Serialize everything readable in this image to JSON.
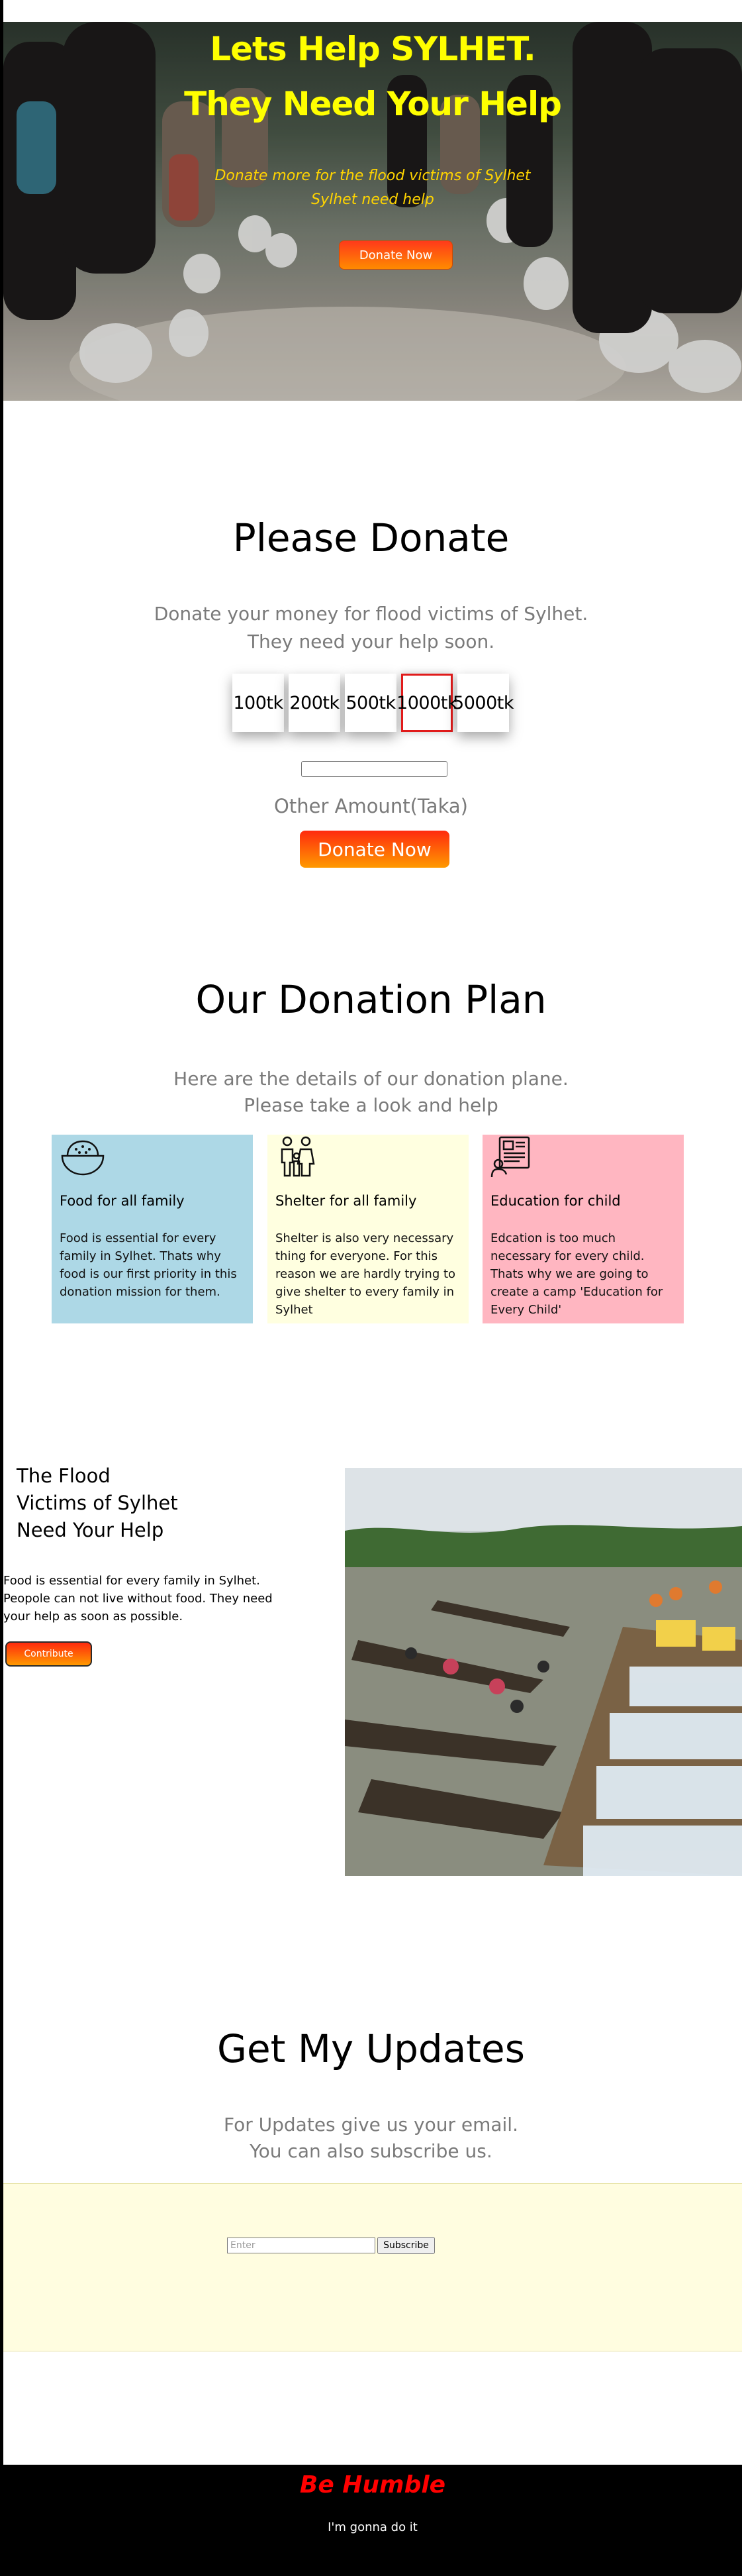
{
  "hero": {
    "title_line1": "Lets Help SYLHET.",
    "title_line2": "They Need Your Help",
    "subtitle_line1": "Donate more for the flood victims of Sylhet",
    "subtitle_line2": "Sylhet need help",
    "button_label": "Donate Now",
    "title_color": "#ffff00"
  },
  "donate": {
    "title": "Please Donate",
    "subtitle_line1": "Donate your money for flood victims of Sylhet.",
    "subtitle_line2": "They need your help soon.",
    "amounts": [
      "100tk",
      "200tk",
      "500tk",
      "1000tk",
      "5000tk"
    ],
    "selected_amount": "1000tk",
    "other_amount_label": "Other Amount(Taka)",
    "button_label": "Donate Now"
  },
  "plan": {
    "title": "Our Donation Plan",
    "subtitle_line1": "Here are the details of our donation plane.",
    "subtitle_line2": "Please take a look and help",
    "cards": [
      {
        "icon": "rice-bowl-icon",
        "title": "Food for all family",
        "text": "Food is essential for every family in Sylhet. Thats why food is our first priority in this donation mission for them.",
        "color": "#add8e6"
      },
      {
        "icon": "family-icon",
        "title": "Shelter for all family",
        "text": "Shelter is also very necessary thing for everyone. For this reason we are hardly trying to give shelter to every family in Sylhet",
        "color": "#ffffe0"
      },
      {
        "icon": "news-icon",
        "title": "Education for child",
        "text": "Edcation is too much necessary for every child. Thats why we are going to create a camp 'Education for Every Child'",
        "color": "#ffb6c1"
      }
    ]
  },
  "flood": {
    "title_line1": "The Flood",
    "title_line2": "Victims of Sylhet",
    "title_line3": "Need Your Help",
    "text": "Food is essential for every family in Sylhet. Peopole can not live without food. They need your help as soon as possible.",
    "button_label": "Contribute"
  },
  "updates": {
    "title": "Get My Updates",
    "subtitle_line1": "For Updates give us your email.",
    "subtitle_line2": "You can also subscribe us.",
    "email_placeholder": "Enter",
    "button_label": "Subscribe"
  },
  "footer": {
    "title": "Be Humble",
    "text": "I'm gonna do it"
  }
}
